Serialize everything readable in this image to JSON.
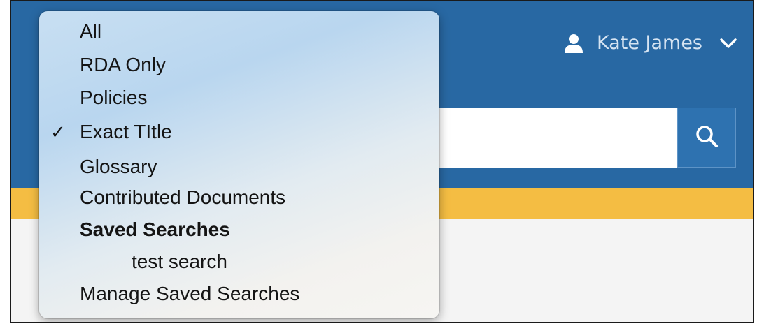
{
  "header": {
    "user_name": "Kate James",
    "user_icon": "user-icon",
    "dropdown_icon": "chevron-down-icon",
    "colors": {
      "bar": "#2868a3",
      "accent_strip": "#f4bd43",
      "search_button": "#2e72b0"
    }
  },
  "search": {
    "value": "",
    "button_icon": "search-icon"
  },
  "search_scope_menu": {
    "items": [
      {
        "label": "All",
        "checked": false
      },
      {
        "label": "RDA Only",
        "checked": false
      },
      {
        "label": "Policies",
        "checked": false
      },
      {
        "label": "Exact TItle",
        "checked": true
      },
      {
        "label": "Glossary",
        "checked": false
      },
      {
        "label": "Contributed Documents",
        "checked": false
      }
    ],
    "check_mark": "✓",
    "saved_searches": {
      "heading": "Saved Searches",
      "items": [
        {
          "label": "test search"
        }
      ]
    },
    "manage_label": "Manage Saved Searches"
  }
}
